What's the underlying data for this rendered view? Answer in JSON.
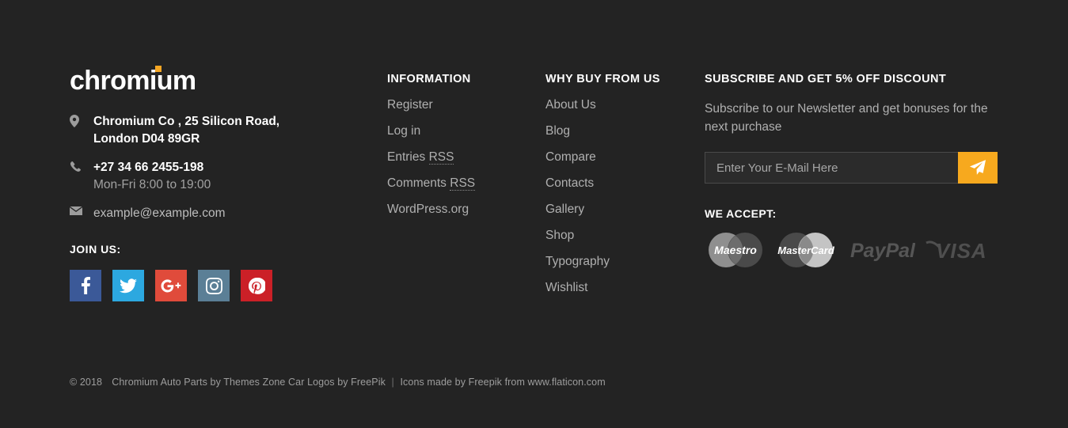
{
  "brand": {
    "logo_text": "chromium",
    "logo_accent_color": "#f5a623"
  },
  "contact": {
    "address_icon": "location-pin-icon",
    "address_line1": "Chromium Co , 25 Silicon Road,",
    "address_line2": "London D04 89GR",
    "phone_icon": "phone-icon",
    "phone": "+27 34 66 2455-198",
    "hours": "Mon-Fri 8:00 to 19:00",
    "email_icon": "envelope-icon",
    "email": "example@example.com"
  },
  "social": {
    "title": "JOIN US:",
    "items": [
      {
        "name": "facebook",
        "label": "Facebook",
        "color": "#3b5998"
      },
      {
        "name": "twitter",
        "label": "Twitter",
        "color": "#2ca8e0"
      },
      {
        "name": "google-plus",
        "label": "Google Plus",
        "color": "#e04b3b"
      },
      {
        "name": "instagram",
        "label": "Instagram",
        "color": "#5b7f96"
      },
      {
        "name": "pinterest",
        "label": "Pinterest",
        "color": "#cb2027"
      }
    ]
  },
  "information": {
    "title": "INFORMATION",
    "links": [
      {
        "label": "Register"
      },
      {
        "label": "Log in"
      },
      {
        "label": "Entries ",
        "abbr": "RSS"
      },
      {
        "label": "Comments ",
        "abbr": "RSS"
      },
      {
        "label": "WordPress.org"
      }
    ]
  },
  "why_buy": {
    "title": "WHY BUY FROM US",
    "links": [
      {
        "label": "About Us"
      },
      {
        "label": "Blog"
      },
      {
        "label": "Compare"
      },
      {
        "label": "Contacts"
      },
      {
        "label": "Gallery"
      },
      {
        "label": "Shop"
      },
      {
        "label": "Typography"
      },
      {
        "label": "Wishlist"
      }
    ]
  },
  "subscribe": {
    "title": "SUBSCRIBE AND GET 5% OFF DISCOUNT",
    "description": "Subscribe to our Newsletter and get bonuses for the next purchase",
    "input_value": "",
    "input_placeholder": "Enter Your E-Mail Here",
    "submit_icon": "paper-plane-icon",
    "submit_color": "#f7a91e"
  },
  "payments": {
    "title": "WE ACCEPT:",
    "methods": [
      {
        "name": "maestro",
        "label": "Maestro"
      },
      {
        "name": "mastercard",
        "label": "MasterCard"
      },
      {
        "name": "paypal",
        "label": "PayPal"
      },
      {
        "name": "visa",
        "label": "VISA"
      }
    ]
  },
  "bottom": {
    "copyright": "© 2018",
    "credit": "Chromium Auto Parts by Themes Zone Car Logos by FreePik",
    "separator": "|",
    "icons_credit": "Icons made by Freepik from www.flaticon.com"
  }
}
